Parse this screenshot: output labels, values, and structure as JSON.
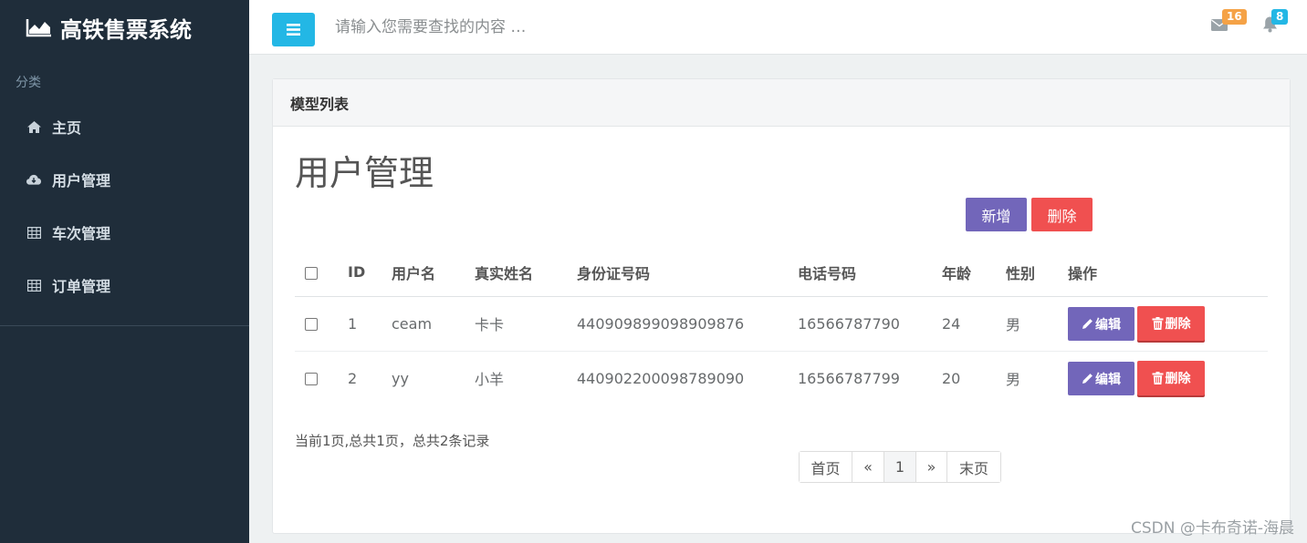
{
  "app": {
    "brand": "高铁售票系统",
    "section_label": "分类"
  },
  "sidebar": {
    "items": [
      {
        "label": "主页",
        "icon": "home-icon"
      },
      {
        "label": "用户管理",
        "icon": "cloud-download-icon"
      },
      {
        "label": "车次管理",
        "icon": "table-icon"
      },
      {
        "label": "订单管理",
        "icon": "table-icon"
      }
    ]
  },
  "topbar": {
    "search_placeholder": "请输入您需要查找的内容 …",
    "mail_count": "16",
    "notification_count": "8"
  },
  "panel": {
    "header": "模型列表",
    "title": "用户管理",
    "add_label": "新增",
    "delete_label": "删除"
  },
  "table": {
    "headers": [
      "ID",
      "用户名",
      "真实姓名",
      "身份证号码",
      "电话号码",
      "年龄",
      "性别",
      "操作"
    ],
    "rows": [
      {
        "id": "1",
        "username": "ceam",
        "realname": "卡卡",
        "idcard": "440909899098909876",
        "phone": "16566787790",
        "age": "24",
        "gender": "男"
      },
      {
        "id": "2",
        "username": "yy",
        "realname": "小羊",
        "idcard": "440902200098789090",
        "phone": "16566787799",
        "age": "20",
        "gender": "男"
      }
    ],
    "edit_label": "编辑",
    "row_delete_label": "删除"
  },
  "pagination": {
    "info": "当前1页,总共1页，总共2条记录",
    "first": "首页",
    "prev": "«",
    "current": "1",
    "next": "»",
    "last": "末页"
  },
  "watermark": "CSDN @卡布奇诺-海晨",
  "colors": {
    "sidebar_bg": "#1f2d3a",
    "accent_blue": "#23b7e5",
    "purple": "#7266ba",
    "red": "#f05050",
    "orange": "#f5a246"
  }
}
